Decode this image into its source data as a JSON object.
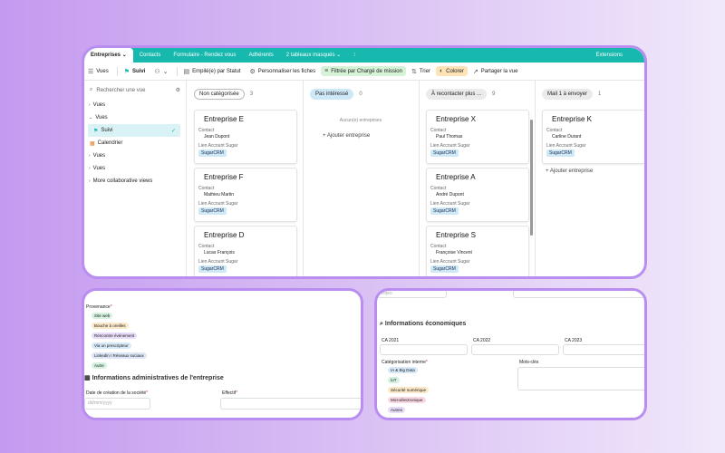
{
  "tabs": [
    "Entreprises",
    "Contacts",
    "Formulaire - Rendez vous",
    "Adhérents",
    "2 tableaux masqués",
    "Extensions"
  ],
  "toolbar": {
    "views": "Vues",
    "view_name": "Suivi",
    "group": "Empilé(e) par Statut",
    "customize": "Personnaliser les fiches",
    "filter": "Filtrée par Chargé de mission",
    "sort": "Trier",
    "color": "Colorer",
    "share": "Partager la vue"
  },
  "sidebar": {
    "search_placeholder": "Rechercher une vue",
    "items": [
      "Vues",
      "Vues",
      "Suivi",
      "Calendrier",
      "Vues",
      "Vues",
      "More collaborative views"
    ]
  },
  "columns": [
    {
      "name": "Non catégorisée",
      "count": "3"
    },
    {
      "name": "Pas intéressé",
      "count": "0"
    },
    {
      "name": "À recontacter plus ...",
      "count": "9"
    },
    {
      "name": "Mail 1 à envoyer",
      "count": "1"
    }
  ],
  "card_labels": {
    "contact": "Contact",
    "link": "Lien Account Sugar",
    "tag": "SugarCRM"
  },
  "cards": {
    "c1": [
      {
        "title": "Entreprise E",
        "contact": "Jean Dupont"
      },
      {
        "title": "Entreprise F",
        "contact": "Mathieu Martin"
      },
      {
        "title": "Entreprise D",
        "contact": "Lucas François"
      }
    ],
    "c3": [
      {
        "title": "Entreprise X",
        "contact": "Paul Thomas"
      },
      {
        "title": "Entreprise A",
        "contact": "André Dupont"
      },
      {
        "title": "Entreprise S",
        "contact": "Françoise Vincent"
      }
    ],
    "c4": [
      {
        "title": "Entreprise K",
        "contact": "Carline Durant"
      }
    ]
  },
  "empty_text": "Aucun(e) entreprises",
  "add_text": "Ajouter entreprise",
  "form1": {
    "provenance_label": "Provenance",
    "provenance": [
      "Site web",
      "Bouche à oreilles",
      "Rencontre événement",
      "Via un prescripteur",
      "Linkedin / Réseaux sociaux",
      "Autre"
    ],
    "section": "Informations administratives de l'entreprise",
    "date_label": "Date de création de la société",
    "date_placeholder": "dd/mm/yyyy",
    "effectif_label": "Effectif"
  },
  "form2": {
    "partial": "Vidéo",
    "section": "Informations économiques",
    "ca": [
      "CA 2021",
      "CA 2022",
      "CA 2023"
    ],
    "cat_label": "Catégorisation interne",
    "cats": [
      "IA & Big Data",
      "IoT",
      "Sécurité numérique",
      "Microélectronique",
      "Autres"
    ],
    "keywords_label": "Mots-clés"
  }
}
